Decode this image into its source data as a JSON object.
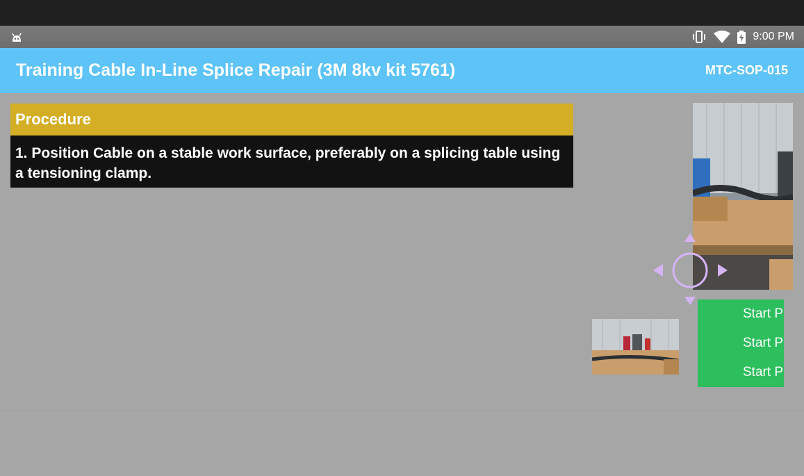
{
  "status_bar": {
    "left_icon": "android-robot-icon",
    "icons": [
      "vibrate-icon",
      "wifi-icon",
      "battery-charging-icon"
    ],
    "time": "9:00 PM"
  },
  "app_bar": {
    "title": "Training Cable In-Line Splice Repair (3M 8kv kit 5761)",
    "code": "MTC-SOP-015",
    "color": "#5ec3f6"
  },
  "procedure": {
    "header": "Procedure",
    "header_color": "#d4ae25",
    "step_text": "1. Position Cable on a stable work surface, preferably on a splicing table using a tensioning clamp."
  },
  "controls": {
    "joystick_color": "#d6b3f5",
    "start_buttons": [
      "Start P",
      "Start P",
      "Start P"
    ],
    "start_panel_color": "#2dbe5d"
  },
  "images": {
    "large_photo": "workshop-cable-splicing-table-photo",
    "small_photo": "workshop-splicing-bench-thumbnail"
  }
}
